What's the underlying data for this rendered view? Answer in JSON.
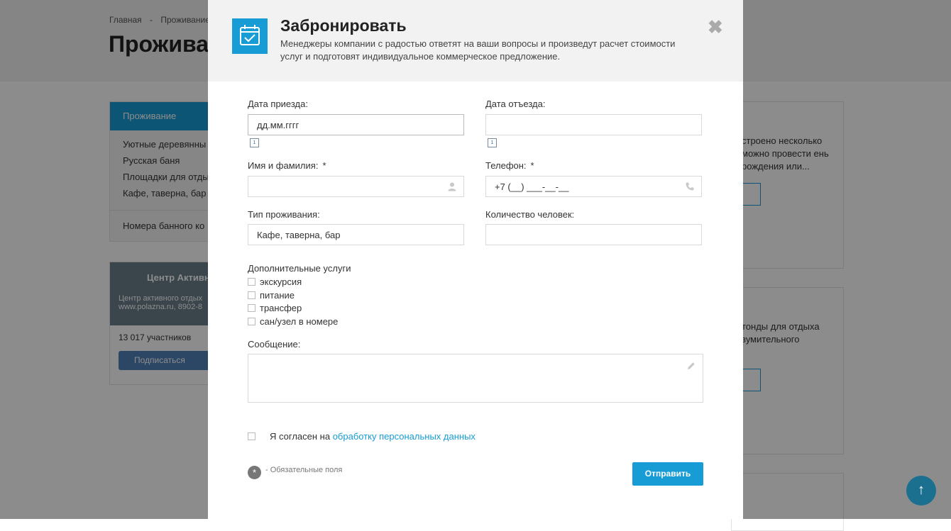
{
  "background": {
    "breadcrumbs": [
      "Главная",
      "-",
      "Проживание"
    ],
    "page_title": "Прожива",
    "sidebar": {
      "active": "Проживание",
      "items": [
        "Уютные деревянны",
        "Русская баня",
        "Площадки для отды",
        "Кафе, таверна, бар"
      ],
      "extra": "Номера банного ко"
    },
    "vk": {
      "brand": "Центр Активн",
      "desc": "Центр активного отдых",
      "site": "www.polazna.ru, 8902-8",
      "members": "13 017 участников",
      "button": "Подписаться"
    },
    "cards": [
      {
        "text": "строено несколько можно провести ень рождения или..."
      },
      {
        "text": "тонды для отдыха зумительного"
      }
    ],
    "scroll_top": "↑"
  },
  "modal": {
    "title": "Забронировать",
    "subtitle": "Менеджеры компании с радостью ответят на ваши вопросы и произведут расчет стоимости услуг и подготовят индивидуальное коммерческое предложение.",
    "close": "✖",
    "fields": {
      "arrival_label": "Дата приезда:",
      "arrival_value": "дд.мм.гггг",
      "departure_label": "Дата отъезда:",
      "departure_value": "",
      "name_label": "Имя и фамилия:",
      "name_value": "",
      "phone_label": "Телефон:",
      "phone_value": "+7 (__) ___-__-__",
      "type_label": "Тип проживания:",
      "type_value": "Кафе, таверна, бар",
      "count_label": "Количество человек:",
      "count_value": "",
      "required_mark": "*"
    },
    "extras_title": "Дополнительные услуги",
    "extras": [
      "экскурсия",
      "питание",
      "трансфер",
      "сан/узел в номере"
    ],
    "message_label": "Сообщение:",
    "agree_text": "Я согласен на",
    "agree_link": "обработку персональных данных",
    "required_note": "- Обязательные поля",
    "submit": "Отправить"
  }
}
